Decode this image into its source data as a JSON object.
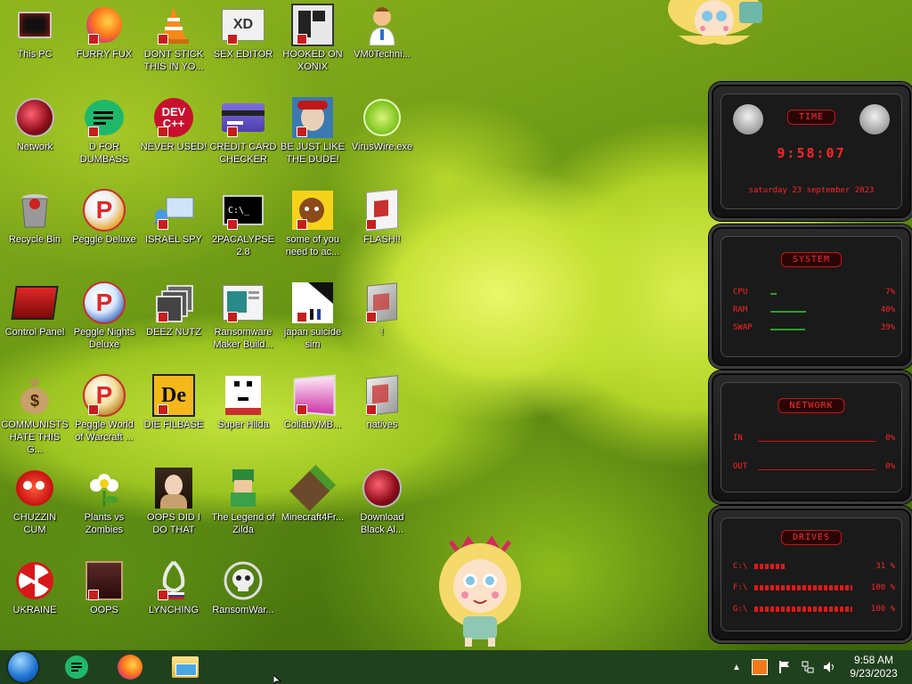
{
  "desktop": {
    "icons": [
      {
        "label": "This PC",
        "icon": "computer-icon"
      },
      {
        "label": "FURRY FUX",
        "icon": "firefox-icon"
      },
      {
        "label": "DONT STICK THIS IN YO...",
        "icon": "vlc-cone-icon"
      },
      {
        "label": "SEX EDITOR",
        "icon": "hex-editor-icon"
      },
      {
        "label": "HOOKED ON XONIX",
        "icon": "xonix-game-icon"
      },
      {
        "label": "VM0Techni...",
        "icon": "doctor-icon"
      },
      {
        "label": "Network",
        "icon": "network-globe-icon"
      },
      {
        "label": "D FOR DUMBASS",
        "icon": "chat-icon"
      },
      {
        "label": "NEVER USED!",
        "icon": "devcpp-icon"
      },
      {
        "label": "CREDIT CARD CHECKER",
        "icon": "credit-card-icon"
      },
      {
        "label": "BE JUST LIKE THE DUDE!",
        "icon": "dude-icon"
      },
      {
        "label": "VirusWire.exe",
        "icon": "lime-icon"
      },
      {
        "label": "Recycle Bin",
        "icon": "recycle-bin-icon"
      },
      {
        "label": "Peggle Deluxe",
        "icon": "peggle-icon"
      },
      {
        "label": "ISRAEL SPY",
        "icon": "spy-monitor-icon"
      },
      {
        "label": "2PACALYPSE 2.8",
        "icon": "terminal-icon"
      },
      {
        "label": "some of you need to ac...",
        "icon": "dog-icon"
      },
      {
        "label": "FLASH!!",
        "icon": "flash-file-icon"
      },
      {
        "label": "Control Panel",
        "icon": "control-panel-icon"
      },
      {
        "label": "Peggle Nights Deluxe",
        "icon": "peggle-nights-icon"
      },
      {
        "label": "DEEZ NUTZ",
        "icon": "stacked-windows-icon"
      },
      {
        "label": "Ransomware Maker Build...",
        "icon": "window-app-icon"
      },
      {
        "label": "japan suicide sim",
        "icon": "japan-sim-icon"
      },
      {
        "label": "!",
        "icon": "blank-file-icon"
      },
      {
        "label": "COMMUNISTS HATE THIS G...",
        "icon": "money-bag-icon"
      },
      {
        "label": "Peggle World of Warcraft ...",
        "icon": "peggle-wow-icon"
      },
      {
        "label": "DIE FILBASE",
        "icon": "de-icon"
      },
      {
        "label": "Super Hilda",
        "icon": "pixel-dog-icon"
      },
      {
        "label": "CollabVMB...",
        "icon": "collabvm-icon"
      },
      {
        "label": "natives",
        "icon": "natives-file-icon"
      },
      {
        "label": "CHUZZIN CUM",
        "icon": "chuzzle-icon"
      },
      {
        "label": "Plants vs Zombies",
        "icon": "flower-icon"
      },
      {
        "label": "OOPS DID I DO THAT",
        "icon": "portrait-icon"
      },
      {
        "label": "The Legend of Zilda",
        "icon": "zilda-icon"
      },
      {
        "label": "Minecraft4Fr...",
        "icon": "minecraft-block-icon"
      },
      {
        "label": "Download Black Al...",
        "icon": "globe-icon"
      },
      {
        "label": "UKRAINE",
        "icon": "radiation-icon"
      },
      {
        "label": "OOPS",
        "icon": "oops-book-icon"
      },
      {
        "label": "LYNCHING",
        "icon": "lynching-icon"
      },
      {
        "label": "RansomWar...",
        "icon": "skull-icon"
      }
    ]
  },
  "widget": {
    "time": {
      "title": "TIME",
      "clock": "9:58:07",
      "date": "saturday 23 september 2023"
    },
    "system": {
      "title": "SYSTEM",
      "rows": [
        {
          "label": "CPU",
          "value": "7%",
          "fraction": 0.07
        },
        {
          "label": "RAM",
          "value": "40%",
          "fraction": 0.4
        },
        {
          "label": "SWAP",
          "value": "39%",
          "fraction": 0.39
        }
      ]
    },
    "network": {
      "title": "NETWORK",
      "rows": [
        {
          "label": "IN",
          "value": "0%"
        },
        {
          "label": "OUT",
          "value": "0%"
        }
      ]
    },
    "drives": {
      "title": "DRIVES",
      "rows": [
        {
          "label": "C:\\",
          "value": "31 %",
          "fraction": 0.31
        },
        {
          "label": "F:\\",
          "value": "100 %",
          "fraction": 1.0
        },
        {
          "label": "G:\\",
          "value": "100 %",
          "fraction": 1.0
        }
      ]
    }
  },
  "taskbar": {
    "pinned": [
      "start-orb-icon",
      "chat-app-icon",
      "firefox-icon",
      "file-explorer-icon"
    ],
    "tray": {
      "time": "9:58 AM",
      "date": "9/23/2023",
      "icons": [
        "show-hidden-chevron-icon",
        "app-tray-icon",
        "flag-icon",
        "network-icon",
        "volume-icon"
      ]
    }
  },
  "colors": {
    "accent_red": "#ff2424",
    "taskbar": "#1a3a1e"
  }
}
